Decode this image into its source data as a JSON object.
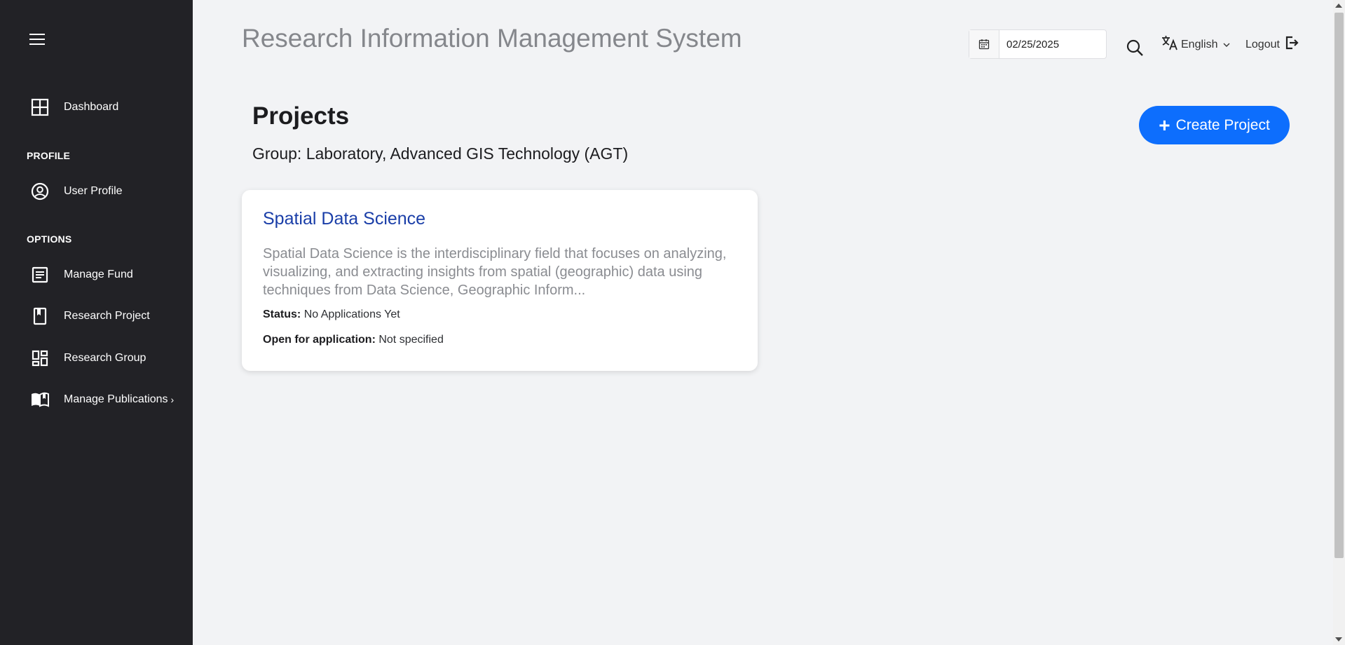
{
  "app": {
    "title": "Research Information Management System"
  },
  "sidebar": {
    "sections": {
      "profile": "PROFILE",
      "options": "OPTIONS"
    },
    "items": [
      {
        "label": "Dashboard",
        "icon": "grid-icon"
      },
      {
        "label": "User Profile",
        "icon": "user-circle-icon"
      },
      {
        "label": "Manage Fund",
        "icon": "document-icon"
      },
      {
        "label": "Research Project",
        "icon": "bookmark-icon"
      },
      {
        "label": "Research Group",
        "icon": "dashboard-icon"
      },
      {
        "label": "Manage Publications",
        "icon": "open-book-icon",
        "chevron": "›"
      }
    ]
  },
  "header": {
    "date_value": "02/25/2025",
    "language": "English",
    "logout": "Logout"
  },
  "main": {
    "heading": "Projects",
    "group": "Group: Laboratory, Advanced GIS Technology (AGT)",
    "create_button": "Create Project",
    "create_icon": "+"
  },
  "project": {
    "title": "Spatial Data Science",
    "description": "Spatial Data Science is the interdisciplinary field that focuses on analyzing, visualizing, and extracting insights from spatial (geographic) data using techniques from Data Science, Geographic Inform...",
    "status_label": "Status:",
    "status_value": "No Applications Yet",
    "open_label": "Open for application:",
    "open_value": "Not specified"
  },
  "colors": {
    "sidebar_bg": "#222226",
    "accent": "#0d6efd",
    "link": "#1a3ea8",
    "page_bg": "#f2f3f5"
  }
}
